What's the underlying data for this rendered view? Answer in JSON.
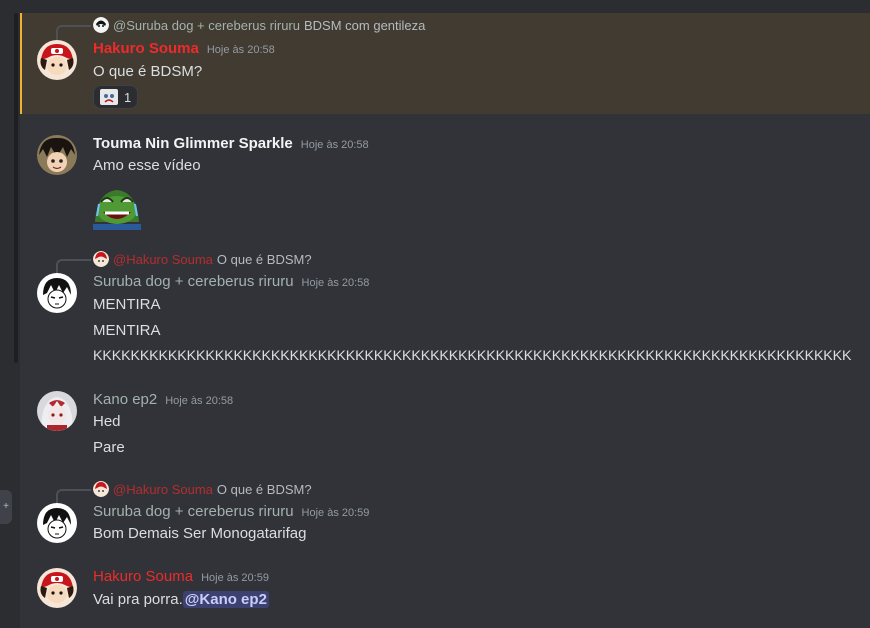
{
  "colors": {
    "background": "#313338",
    "hakuro_name": "#ed2b2b",
    "default_name": "#f2f3f5",
    "muted_name": "#a3b2ad",
    "mention_bg": "#5865f2",
    "highlight_bar": "#f0b232"
  },
  "messages": [
    {
      "reply": {
        "author": "@Suruba dog + cereberus riruru",
        "text": "BDSM com gentileza"
      },
      "author": "Hakuro Souma",
      "timestamp": "Hoje às 20:58",
      "lines": [
        "O que é BDSM?"
      ],
      "reaction": {
        "emoji": "sad-emoji-icon",
        "count": "1"
      }
    },
    {
      "author": "Touma Nin Glimmer Sparkle",
      "timestamp": "Hoje às 20:58",
      "lines": [
        "Amo esse vídeo"
      ],
      "emote": "laughing-pepe-emote"
    },
    {
      "reply": {
        "author": "@Hakuro Souma",
        "text": "O que é BDSM?"
      },
      "author": "Suruba dog + cereberus riruru",
      "timestamp": "Hoje às 20:58",
      "lines": [
        "MENTIRA",
        "MENTIRA",
        "KKKKKKKKKKKKKKKKKKKKKKKKKKKKKKKKKKKKKKKKKKKKKKKKKKKKKKKKKKKKKKKKKKKKKKKKKKKKKKKKK"
      ]
    },
    {
      "author": "Kano ep2",
      "timestamp": "Hoje às 20:58",
      "lines": [
        "Hed",
        "Pare"
      ]
    },
    {
      "reply": {
        "author": "@Hakuro Souma",
        "text": "O que é BDSM?"
      },
      "author": "Suruba dog + cereberus riruru",
      "timestamp": "Hoje às 20:59",
      "lines": [
        "Bom Demais Ser Monogatarifag"
      ]
    },
    {
      "author": "Hakuro Souma",
      "timestamp": "Hoje às 20:59",
      "lines": [
        "Vai pra porra."
      ],
      "mention": "@Kano ep2"
    }
  ]
}
